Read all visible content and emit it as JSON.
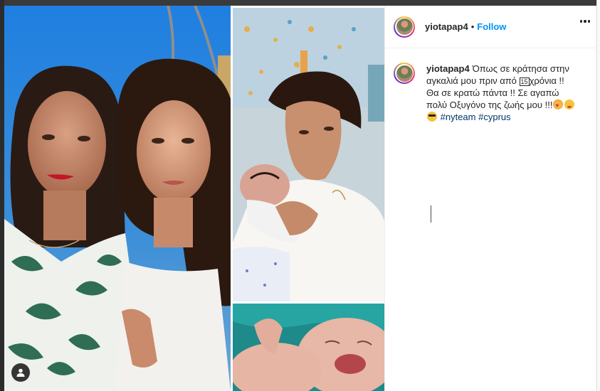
{
  "post": {
    "username": "yiotapap4",
    "separator": "•",
    "follow_label": "Follow",
    "more_icon": "more-options-icon"
  },
  "caption": {
    "username": "yiotapap4",
    "line1": "Όπως σε κράτησα στην",
    "line2_a": "αγκαλιά μου πριν από",
    "line2_num": "15",
    "line2_b": "χρόνια !!",
    "line3": "Θα σε κρατώ πάντα !! Σε αγαπώ",
    "line4": "πολύ Οξυγόνο της ζωής μου !!!",
    "hashtag1": "#nyteam",
    "hashtag2": "#cyprus"
  },
  "media": {
    "tag_icon": "user-tag-icon"
  },
  "colors": {
    "follow": "#0095f6",
    "hashtag": "#00376b",
    "text": "#262626"
  }
}
